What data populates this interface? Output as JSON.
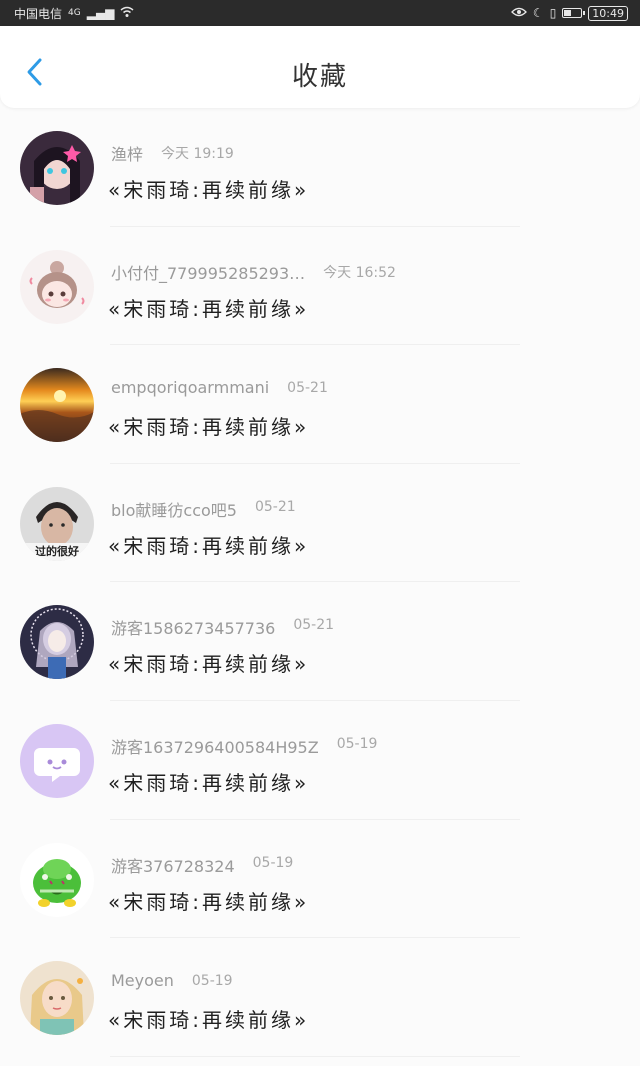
{
  "status_bar": {
    "carrier": "中国电信",
    "network": "4G",
    "time": "10:49",
    "battery_level": 0.45
  },
  "header": {
    "title": "收藏",
    "back_icon": "chevron-left-icon",
    "accent_color": "#2e9be6"
  },
  "items": [
    {
      "user": "渔梓",
      "date": "今天 19:19",
      "book": "«宋雨琦:再续前缘»",
      "avatar": "anime-girl-dark"
    },
    {
      "user": "小付付_779995285293…",
      "date": "今天 16:52",
      "book": "«宋雨琦:再续前缘»",
      "avatar": "chibi-girl"
    },
    {
      "user": "empqoriqoarmmani",
      "date": "05-21",
      "book": "«宋雨琦:再续前缘»",
      "avatar": "sunset-clouds"
    },
    {
      "user": "blo献睡彷cco吧5",
      "date": "05-21",
      "book": "«宋雨琦:再续前缘»",
      "avatar": "young-man"
    },
    {
      "user": "游客1586273457736",
      "date": "05-21",
      "book": "«宋雨琦:再续前缘»",
      "avatar": "anime-lace"
    },
    {
      "user": "游客1637296400584H95Z",
      "date": "05-19",
      "book": "«宋雨琦:再续前缘»",
      "avatar": "purple-chat"
    },
    {
      "user": "游客376728324",
      "date": "05-19",
      "book": "«宋雨琦:再续前缘»",
      "avatar": "green-mascot"
    },
    {
      "user": "Meyoen",
      "date": "05-19",
      "book": "«宋雨琦:再续前缘»",
      "avatar": "blonde-girl"
    }
  ]
}
